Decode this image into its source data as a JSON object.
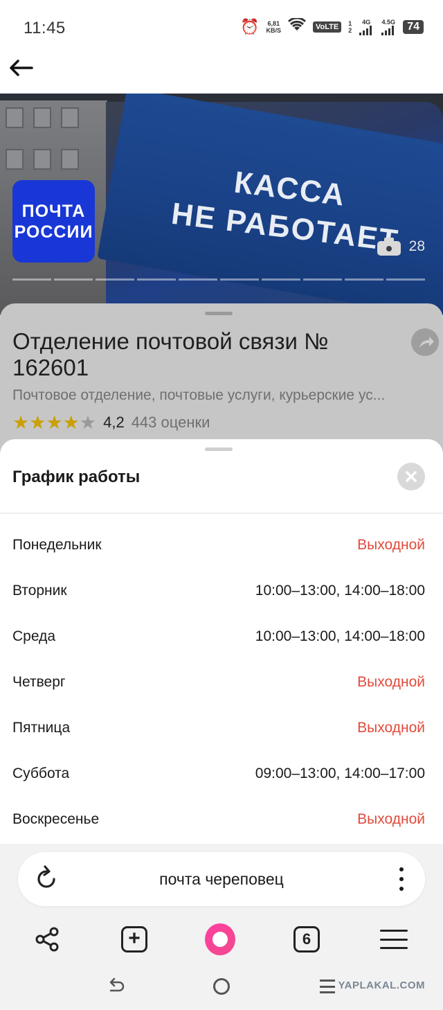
{
  "status_bar": {
    "time": "11:45",
    "net_speed_value": "6,81",
    "net_speed_unit": "KB/S",
    "volte": "VoLTE",
    "sim_1": "1",
    "sim_2": "2",
    "net_1": "4G",
    "net_2": "4.5G",
    "battery": "74"
  },
  "photo": {
    "logo_line1": "ПОЧТА",
    "logo_line2": "РОССИИ",
    "sign_line1": "КАССА",
    "sign_line2": "НЕ РАБОТАЕТ",
    "count": "28",
    "segments": 10
  },
  "place": {
    "title": "Отделение почтовой связи № 162601",
    "subtitle": "Почтовое отделение, почтовые услуги, курьерские ус...",
    "rating": "4,2",
    "rating_stars_filled": 4,
    "rating_count": "443 оценки"
  },
  "schedule": {
    "title": "График работы",
    "days": [
      {
        "day": "Понедельник",
        "hours": "Выходной",
        "off": true
      },
      {
        "day": "Вторник",
        "hours": "10:00–13:00, 14:00–18:00",
        "off": false
      },
      {
        "day": "Среда",
        "hours": "10:00–13:00, 14:00–18:00",
        "off": false
      },
      {
        "day": "Четверг",
        "hours": "Выходной",
        "off": true
      },
      {
        "day": "Пятница",
        "hours": "Выходной",
        "off": true
      },
      {
        "day": "Суббота",
        "hours": "09:00–13:00, 14:00–17:00",
        "off": false
      },
      {
        "day": "Воскресенье",
        "hours": "Выходной",
        "off": true
      }
    ]
  },
  "browser": {
    "search_text": "почта череповец",
    "tabs_count": "6"
  },
  "watermark": "YAPLAKAL.COM",
  "colors": {
    "closed": "#e24a3b",
    "logo_blue": "#1837d6",
    "star": "#c9a006",
    "alice": "#f04a8c"
  },
  "icons": [
    "back-arrow-icon",
    "camera-icon",
    "share-arrow-icon",
    "close-icon",
    "reload-icon",
    "kebab-menu-icon",
    "share-icon",
    "add-tab-icon",
    "alice-icon",
    "tabs-icon",
    "hamburger-menu-icon"
  ]
}
